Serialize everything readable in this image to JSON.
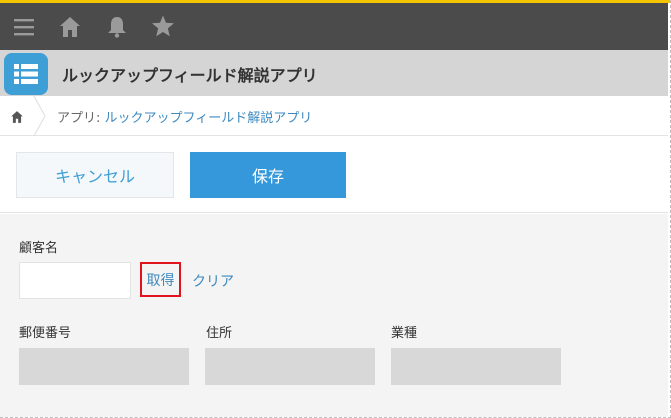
{
  "colors": {
    "accent_line": "#f5c400",
    "topbar": "#4b4b4b",
    "app_icon": "#3d9fd5",
    "save_button": "#3498db",
    "link": "#3d89bf",
    "highlight_box": "#e0141d"
  },
  "topbar": {
    "icons": [
      "menu-icon",
      "home-icon",
      "bell-icon",
      "star-icon"
    ]
  },
  "app": {
    "title": "ルックアップフィールド解説アプリ",
    "icon": "list-icon"
  },
  "breadcrumb": {
    "prefix": "アプリ: ",
    "app_name": "ルックアップフィールド解説アプリ"
  },
  "toolbar": {
    "cancel_label": "キャンセル",
    "save_label": "保存"
  },
  "form": {
    "customer_name": {
      "label": "顧客名",
      "value": "",
      "get_label": "取得",
      "clear_label": "クリア"
    },
    "fields": [
      {
        "label": "郵便番号",
        "value": ""
      },
      {
        "label": "住所",
        "value": ""
      },
      {
        "label": "業種",
        "value": ""
      }
    ]
  }
}
